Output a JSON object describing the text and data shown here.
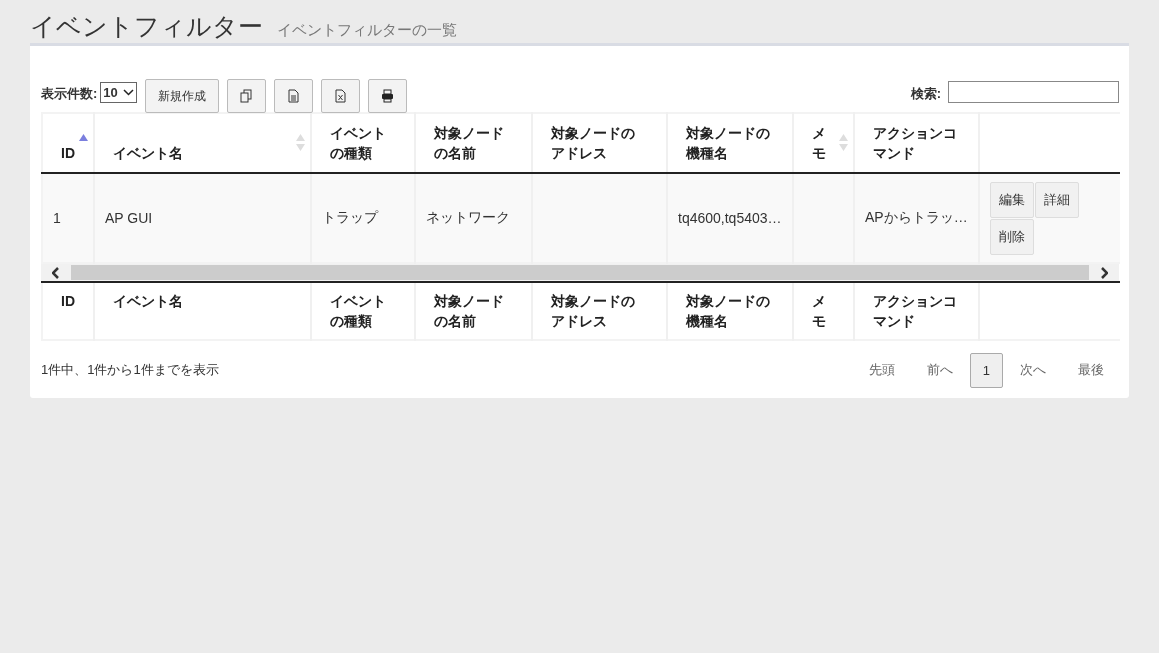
{
  "page_header": {
    "title": "イベントフィルター",
    "subtitle": "イベントフィルターの一覧"
  },
  "toolbar": {
    "page_size_label": "表示件数:",
    "page_size": "10",
    "buttons": [
      {
        "kind": "text",
        "label": "新規作成"
      },
      {
        "kind": "copy"
      },
      {
        "kind": "csv"
      },
      {
        "kind": "excel"
      },
      {
        "kind": "print"
      }
    ],
    "search_label": "検索:"
  },
  "table": {
    "columns": [
      {
        "lines": [
          "ID"
        ],
        "sortable": true,
        "sorted_ascending": true
      },
      {
        "lines": [
          "イベント名"
        ],
        "sortable": true,
        "sorted_ascending": false
      },
      {
        "lines": [
          "イベント",
          "の種類"
        ],
        "sortable": false
      },
      {
        "lines": [
          "対象ノード",
          "の名前"
        ],
        "sortable": false
      },
      {
        "lines": [
          "対象ノードの",
          "アドレス"
        ],
        "sortable": false
      },
      {
        "lines": [
          "対象ノードの",
          "機種名"
        ],
        "sortable": false
      },
      {
        "lines": [
          "メ",
          "モ"
        ],
        "sortable": true,
        "sorted_ascending": false
      },
      {
        "lines": [
          "アクションコ",
          "マンド"
        ],
        "sortable": false
      }
    ],
    "footer_columns": [
      {
        "lines": [
          "ID"
        ]
      },
      {
        "lines": [
          "イベント名"
        ]
      },
      {
        "lines": [
          "イベント",
          "の種類"
        ]
      },
      {
        "lines": [
          "対象ノード",
          "の名前"
        ]
      },
      {
        "lines": [
          "対象ノードの",
          "アドレス"
        ]
      },
      {
        "lines": [
          "対象ノードの",
          "機種名"
        ]
      },
      {
        "lines": [
          "メ",
          "モ"
        ]
      },
      {
        "lines": [
          "アクションコ",
          "マンド"
        ]
      }
    ],
    "rows": [
      {
        "cells": [
          "1",
          "AP GUI",
          "トラップ",
          "ネットワーク",
          "",
          "tq4600,tq5403…",
          "",
          "APからトラッ…"
        ],
        "actions": [
          "編集",
          "詳細",
          "削除"
        ]
      }
    ]
  },
  "footer": {
    "info": "1件中、1件から1件までを表示",
    "pagination": [
      {
        "label": "先頭",
        "selected": false
      },
      {
        "label": "前へ",
        "selected": false
      },
      {
        "label": "1",
        "selected": true
      },
      {
        "label": "次へ",
        "selected": false
      },
      {
        "label": "最後",
        "selected": false
      }
    ]
  }
}
